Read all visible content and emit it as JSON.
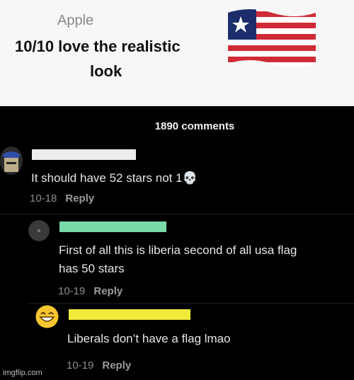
{
  "post": {
    "author": "Apple",
    "line1": "10/10 love the realistic",
    "line2": "look",
    "flag_icon": "liberia-flag-emoji"
  },
  "comments_count": "1890 comments",
  "comments": [
    {
      "text": "It should have 52 stars not 1💀",
      "date": "10-18",
      "reply": "Reply",
      "username_bar_color": "#ececec"
    },
    {
      "text_line1": "First of all this is liberia second of all usa flag",
      "text_line2": "has 50 stars",
      "date": "10-19",
      "reply": "Reply",
      "username_bar_color": "#7ad9a8"
    },
    {
      "text": "Liberals don’t have a flag lmao",
      "date": "10-19",
      "reply": "Reply",
      "username_bar_color": "#f2ea3a"
    }
  ],
  "watermark": "imgflip.com"
}
